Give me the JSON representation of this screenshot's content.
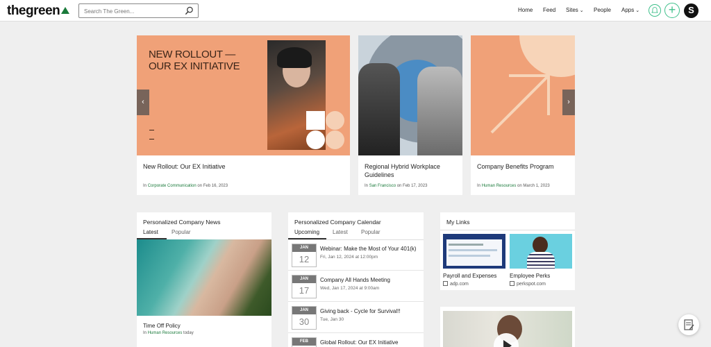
{
  "header": {
    "logo": "thegreen",
    "search_placeholder": "Search The Green...",
    "nav": [
      {
        "label": "Home"
      },
      {
        "label": "Feed"
      },
      {
        "label": "Sites",
        "dropdown": true
      },
      {
        "label": "People"
      },
      {
        "label": "Apps",
        "dropdown": true
      }
    ],
    "avatar_letter": "S"
  },
  "carousel": {
    "slides": [
      {
        "headline": "NEW ROLLOUT — OUR EX INITIATIVE",
        "title": "New Rollout: Our EX Initiative",
        "meta_prefix": "In",
        "category": "Corporate Communication",
        "date_text": "on Feb 16, 2023"
      },
      {
        "title": "Regional Hybrid Workplace Guidelines",
        "meta_prefix": "In",
        "category": "San Francisco",
        "date_text": "on Feb 17, 2023"
      },
      {
        "title": "Company Benefits Program",
        "meta_prefix": "In",
        "category": "Human Resources",
        "date_text": "on March 1, 2023"
      }
    ]
  },
  "news": {
    "title": "Personalized Company News",
    "tabs": [
      "Latest",
      "Popular"
    ],
    "item_title": "Time Off Policy",
    "item_meta_prefix": "In",
    "item_category": "Human Resources",
    "item_date": "today"
  },
  "calendar": {
    "title": "Personalized Company Calendar",
    "tabs": [
      "Upcoming",
      "Latest",
      "Popular"
    ],
    "events": [
      {
        "month": "JAN",
        "day": "12",
        "title": "Webinar: Make the Most of Your 401(k)",
        "time": "Fri, Jan 12, 2024 at 12:00pm"
      },
      {
        "month": "JAN",
        "day": "17",
        "title": "Company All Hands Meeting",
        "time": "Wed, Jan 17, 2024 at 9:00am"
      },
      {
        "month": "JAN",
        "day": "30",
        "title": "Giving back - Cycle for Survival!!",
        "time": "Tue, Jan 30"
      },
      {
        "month": "FEB",
        "day": "",
        "title": "Global Rollout: Our EX Initiative",
        "time": ""
      }
    ]
  },
  "links": {
    "title": "My Links",
    "items": [
      {
        "label": "Payroll and Expenses",
        "url": "adp.com"
      },
      {
        "label": "Employee Perks",
        "url": "perkspot.com"
      }
    ]
  },
  "colors": {
    "accent": "#1a7a3b",
    "brand_green": "#3dbf8a",
    "peach": "#f0a178"
  }
}
